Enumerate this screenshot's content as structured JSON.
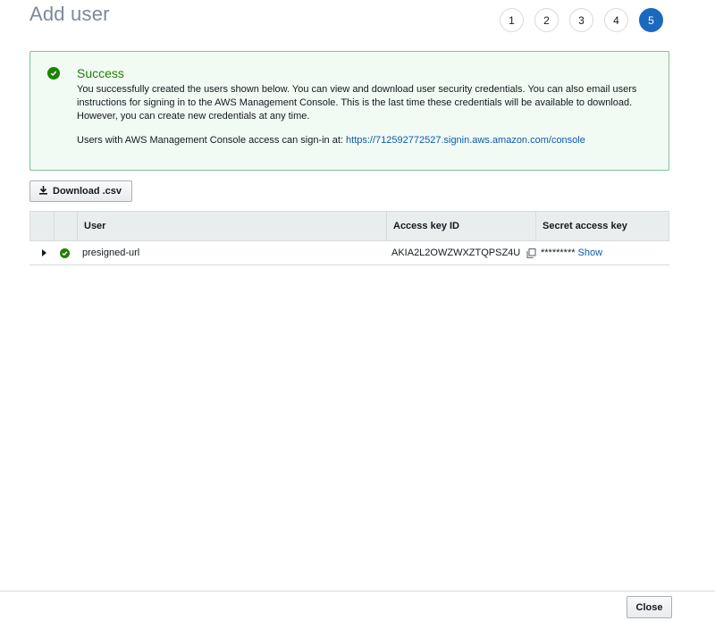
{
  "header": {
    "title": "Add user",
    "steps": [
      "1",
      "2",
      "3",
      "4",
      "5"
    ],
    "active_step": "5"
  },
  "alert": {
    "icon": "check-circle-icon",
    "title": "Success",
    "message": "You successfully created the users shown below. You can view and download user security credentials. You can also email users instructions for signing in to the AWS Management Console. This is the last time these credentials will be available to download. However, you can create new credentials at any time.",
    "signin_prefix": "Users with AWS Management Console access can sign-in at: ",
    "signin_url": "https://712592772527.signin.aws.amazon.com/console"
  },
  "toolbar": {
    "download_label": "Download .csv",
    "download_icon": "download-icon"
  },
  "table": {
    "columns": [
      "",
      "",
      "User",
      "Access key ID",
      "Secret access key"
    ],
    "rows": [
      {
        "user": "presigned-url",
        "access_key_id": "AKIA2L2OWZWXZTQPSZ4U",
        "secret_masked": "*********",
        "show_label": "Show"
      }
    ]
  },
  "footer": {
    "close_label": "Close"
  },
  "colors": {
    "success": "#1d8102",
    "alert_bg": "#f1faf3",
    "alert_border": "#7fc29a",
    "link": "#0a5bb4",
    "active_step": "#1a69bf"
  }
}
